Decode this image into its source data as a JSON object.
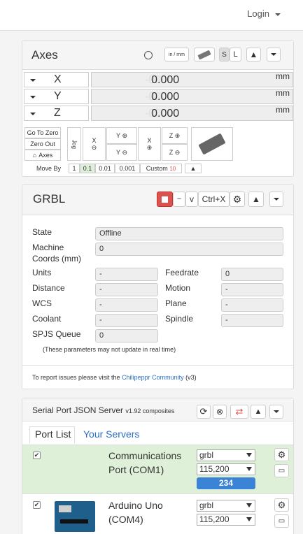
{
  "header": {
    "login": "Login"
  },
  "axes": {
    "title": "Axes",
    "units_btn": "in / mm",
    "s_btn": "S",
    "l_btn": "L",
    "rows": [
      {
        "axis": "X",
        "ghost": "-00",
        "value": "0.000",
        "unit": "mm"
      },
      {
        "axis": "Y",
        "ghost": "-00",
        "value": "0.000",
        "unit": "mm"
      },
      {
        "axis": "Z",
        "ghost": "-00",
        "value": "0.000",
        "unit": "mm"
      }
    ],
    "go_to_zero": "Go To Zero",
    "zero_out": "Zero Out",
    "axes_btn": "Axes",
    "jog": "Jog",
    "x": "X",
    "y": "Y",
    "z": "Z",
    "move_by": "Move By",
    "steps": [
      "1",
      "0.1",
      "0.01",
      "0.001"
    ],
    "custom": "Custom",
    "custom_val": "10"
  },
  "grbl": {
    "title": "GRBL",
    "tilde": "~",
    "v": "v",
    "ctrlx": "Ctrl+X",
    "state_label": "State",
    "state": "Offline",
    "machine_label": "Machine Coords (mm)",
    "machine": "0",
    "units_label": "Units",
    "units": "-",
    "feed_label": "Feedrate",
    "feed": "0",
    "distance_label": "Distance",
    "distance": "-",
    "motion_label": "Motion",
    "motion": "-",
    "wcs_label": "WCS",
    "wcs": "-",
    "plane_label": "Plane",
    "plane": "-",
    "coolant_label": "Coolant",
    "coolant": "-",
    "spindle_label": "Spindle",
    "spindle": "-",
    "queue_label": "SPJS Queue",
    "queue": "0",
    "note": "(These parameters may not update in real time)",
    "report_pre": "To report issues please visit the ",
    "report_link": "Chilipeppr Community",
    "report_post": " (v3)"
  },
  "spjs": {
    "title": "Serial Port JSON Server",
    "version": "v1.92 composites",
    "tabs": [
      "Port List",
      "Your Servers"
    ],
    "ports": [
      {
        "name": "Communications Port (COM1)",
        "checked": "✔",
        "buffer": "grbl",
        "baud": "115,200",
        "count": "234"
      },
      {
        "name": "Arduino Uno (COM4)",
        "checked": "✔",
        "buffer": "grbl",
        "baud": "115,200"
      }
    ]
  },
  "colors": {
    "accent": "#2a6fc9",
    "danger": "#d9534f",
    "green": "#dff0d8",
    "progress": "#3b83d6"
  }
}
